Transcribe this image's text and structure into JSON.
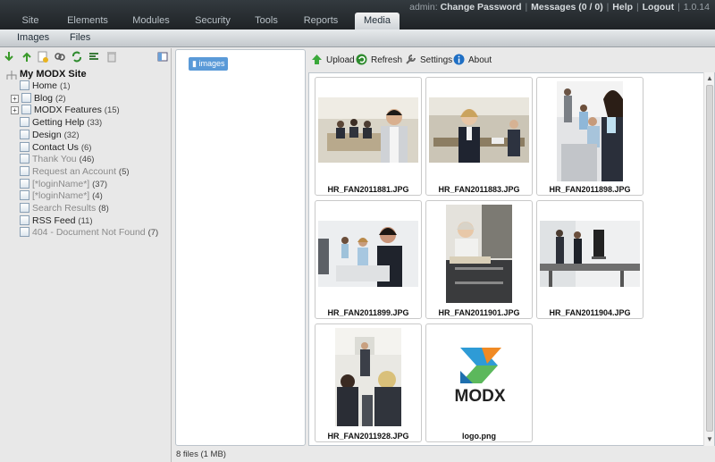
{
  "nav": {
    "tabs": [
      "Site",
      "Elements",
      "Modules",
      "Security",
      "Tools",
      "Reports",
      "Media"
    ],
    "active": "Media"
  },
  "toplinks": {
    "user": "admin:",
    "change_password": "Change Password",
    "messages": "Messages (0 / 0)",
    "help": "Help",
    "logout": "Logout",
    "version": "1.0.14"
  },
  "subnav": {
    "images": "Images",
    "files": "Files"
  },
  "tree": {
    "root": "My MODX Site",
    "items": [
      {
        "label": "Home",
        "count": "(1)",
        "muted": false,
        "expander": false
      },
      {
        "label": "Blog",
        "count": "(2)",
        "muted": false,
        "expander": true
      },
      {
        "label": "MODX Features",
        "count": "(15)",
        "muted": false,
        "expander": true
      },
      {
        "label": "Getting Help",
        "count": "(33)",
        "muted": false,
        "expander": false
      },
      {
        "label": "Design",
        "count": "(32)",
        "muted": false,
        "expander": false
      },
      {
        "label": "Contact Us",
        "count": "(6)",
        "muted": false,
        "expander": false
      },
      {
        "label": "Thank You",
        "count": "(46)",
        "muted": true,
        "expander": false
      },
      {
        "label": "Request an Account",
        "count": "(5)",
        "muted": true,
        "expander": false
      },
      {
        "label": "[*loginName*]",
        "count": "(37)",
        "muted": true,
        "expander": false
      },
      {
        "label": "[*loginName*]",
        "count": "(4)",
        "muted": true,
        "expander": false
      },
      {
        "label": "Search Results",
        "count": "(8)",
        "muted": true,
        "expander": false
      },
      {
        "label": "RSS Feed",
        "count": "(11)",
        "muted": false,
        "expander": false
      },
      {
        "label": "404 - Document Not Found",
        "count": "(7)",
        "muted": true,
        "expander": false
      }
    ]
  },
  "folders": {
    "images": "images"
  },
  "toolbar": {
    "upload": "Upload",
    "refresh": "Refresh",
    "settings": "Settings",
    "about": "About"
  },
  "files": [
    "HR_FAN2011881.JPG",
    "HR_FAN2011883.JPG",
    "HR_FAN2011898.JPG",
    "HR_FAN2011899.JPG",
    "HR_FAN2011901.JPG",
    "HR_FAN2011904.JPG",
    "HR_FAN2011928.JPG",
    "logo.png"
  ],
  "logo_text": "MODX",
  "status": "8 files (1 MB)",
  "colors": {
    "accent": "#5a9ad8",
    "nav_bg": "#2a3034",
    "modx_orange": "#f08a24",
    "modx_blue": "#2e9bd6",
    "modx_green": "#5cb85c"
  }
}
